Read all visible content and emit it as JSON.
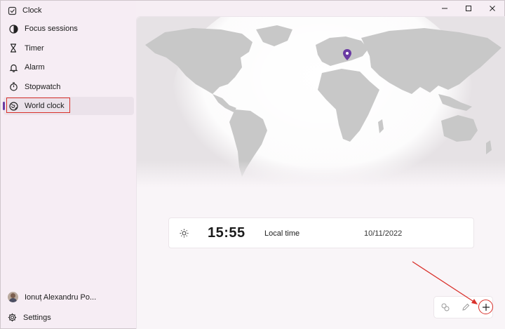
{
  "app": {
    "title": "Clock"
  },
  "sidebar": {
    "items": [
      {
        "label": "Focus sessions",
        "icon": "focus-icon"
      },
      {
        "label": "Timer",
        "icon": "hourglass-icon"
      },
      {
        "label": "Alarm",
        "icon": "bell-icon"
      },
      {
        "label": "Stopwatch",
        "icon": "stopwatch-icon"
      },
      {
        "label": "World clock",
        "icon": "globe-icon",
        "active": true
      }
    ],
    "profile_name": "Ionuț Alexandru Po...",
    "settings_label": "Settings"
  },
  "world_clock": {
    "time": "15:55",
    "label": "Local time",
    "date": "10/11/2022",
    "icon": "sun-icon"
  },
  "toolbar": {
    "icons": [
      "compare-icon",
      "edit-icon",
      "add-icon"
    ]
  },
  "colors": {
    "accent": "#6a3aa3",
    "annotation": "#d9302a",
    "map_land": "#c9c9c9"
  }
}
